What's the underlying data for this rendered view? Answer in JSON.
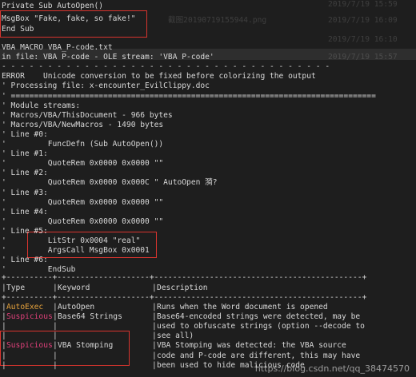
{
  "colors": {
    "background": "#1e1e1e",
    "text": "#d8d8d8",
    "highlight_border": "#d8342e",
    "autoexec": "#e6a23c",
    "suspicious": "#e0407a",
    "band": "#2e2e2e"
  },
  "code_lines": [
    "Private Sub AutoOpen()",
    "MsgBox \"Fake, fake, so fake!\"",
    "End Sub"
  ],
  "background_files": [
    {
      "name": "截图20190719155944.png",
      "date": "2019/7/19 15:59"
    },
    {
      "name": "",
      "date": "2019/7/19 16:09"
    },
    {
      "name": "",
      "date": "2019/7/19 16:10"
    },
    {
      "name": "",
      "date": "2019/7/19 15:57"
    }
  ],
  "output_lines": [
    "VBA MACRO VBA_P-code.txt",
    "in file: VBA P-code - OLE stream: 'VBA P-code'",
    "- - - - - - - - - - - - - - - - - - - - - - - - - - - - - - - - - - - -",
    "ERROR    Unicode conversion to be fixed before colorizing the output",
    "' Processing file: x-encounter_EvilClippy.doc",
    "' ===============================================================================",
    "' Module streams:",
    "' Macros/VBA/ThisDocument - 966 bytes",
    "' Macros/VBA/NewMacros - 1490 bytes",
    "' Line #0:",
    "'         FuncDefn (Sub AutoOpen())",
    "' Line #1:",
    "'         QuoteRem 0x0000 0x0000 \"\"",
    "' Line #2:",
    "'         QuoteRem 0x0000 0x000C \" AutoOpen 漪?",
    "' Line #3:",
    "'         QuoteRem 0x0000 0x0000 \"\"",
    "' Line #4:",
    "'         QuoteRem 0x0000 0x0000 \"\"",
    "' Line #5:",
    "'         LitStr 0x0004 \"real\"",
    "'         ArgsCall MsgBox 0x0001",
    "' Line #6:",
    "'         EndSub"
  ],
  "table": {
    "border_top": "+----------+--------------------+---------------------------------------------+",
    "header": [
      "Type",
      "Keyword",
      "Description"
    ],
    "border_mid": "+----------+--------------------+---------------------------------------------+",
    "rows": [
      {
        "type": "AutoExec",
        "keyword": "AutoOpen",
        "desc": "Runs when the Word document is opened"
      },
      {
        "type": "Suspicious",
        "keyword": "Base64 Strings",
        "desc": "Base64-encoded strings were detected, may be"
      },
      {
        "type": "",
        "keyword": "",
        "desc": "used to obfuscate strings (option --decode to"
      },
      {
        "type": "",
        "keyword": "",
        "desc": "see all)"
      },
      {
        "type": "Suspicious",
        "keyword": "VBA Stomping",
        "desc": "VBA Stomping was detected: the VBA source"
      },
      {
        "type": "",
        "keyword": "",
        "desc": "code and P-code are different, this may have"
      },
      {
        "type": "",
        "keyword": "",
        "desc": "been used to hide malicious code"
      }
    ]
  },
  "watermark": "https://blog.csdn.net/qq_38474570"
}
